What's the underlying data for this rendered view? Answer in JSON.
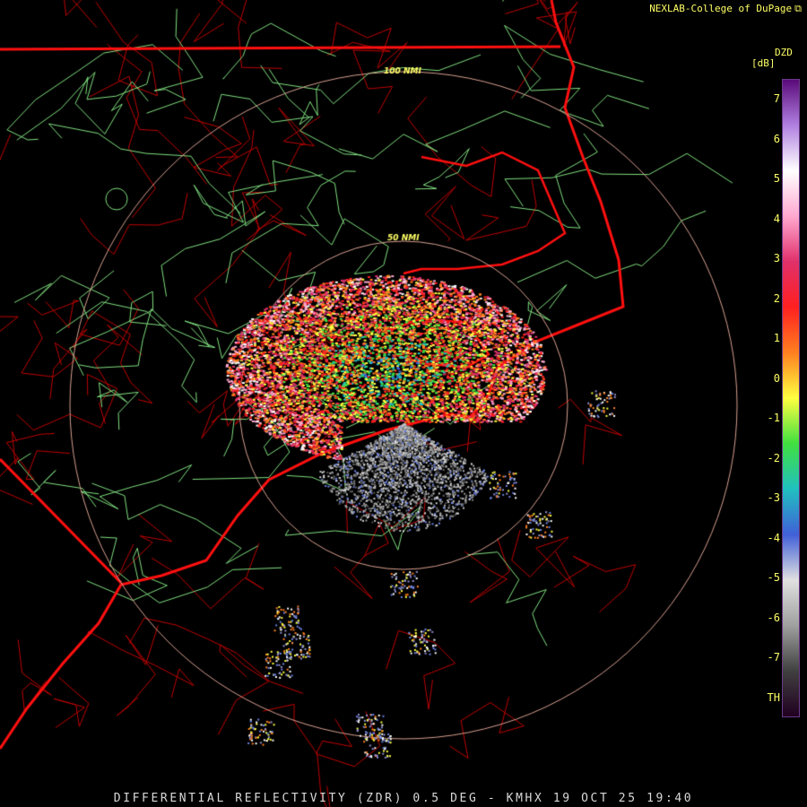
{
  "header": {
    "credit": "NEXLAB-College of DuPage",
    "logo_icon": "cod-logo-icon"
  },
  "footer": {
    "title": "DIFFERENTIAL REFLECTIVITY (ZDR) 0.5 DEG - KMHX 19 OCT 25 19:40"
  },
  "range_rings": [
    "50 NMI",
    "100 NMI"
  ],
  "legend": {
    "product": "DZD",
    "units": "[dB]",
    "ticks": [
      "7",
      "6",
      "5",
      "4",
      "3",
      "2",
      "1",
      "0",
      "-1",
      "-2",
      "-3",
      "-4",
      "-5",
      "-6",
      "-7",
      "TH"
    ],
    "colors": [
      "#5a0a7a",
      "#b080e0",
      "#ffffff",
      "#ffa8d0",
      "#e0306a",
      "#ff2020",
      "#ff8020",
      "#ffff40",
      "#40e040",
      "#20c0c0",
      "#4060d8",
      "#e0e0e0",
      "#a0a0a0",
      "#404040",
      "#200020"
    ]
  },
  "colors": {
    "state_border": "#ff1010",
    "county_border": "#c00000",
    "highway": "#80e080",
    "ring": "#d8a090",
    "text": "#ffff66"
  }
}
